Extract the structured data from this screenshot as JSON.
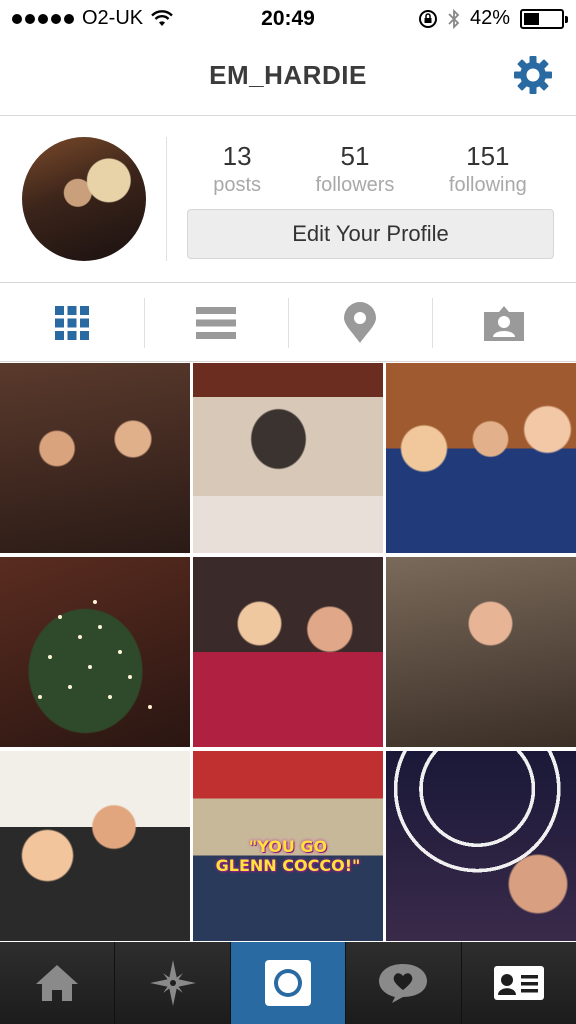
{
  "status_bar": {
    "carrier": "O2-UK",
    "time": "20:49",
    "battery": "42%",
    "battery_level": 0.42
  },
  "nav": {
    "title": "EM_HARDIE",
    "settings_icon": "gear-icon"
  },
  "profile": {
    "stats": [
      {
        "value": "13",
        "label": "posts"
      },
      {
        "value": "51",
        "label": "followers"
      },
      {
        "value": "151",
        "label": "following"
      }
    ],
    "edit_button": "Edit Your Profile"
  },
  "view_tabs": [
    {
      "icon": "grid-icon",
      "selected": true
    },
    {
      "icon": "list-icon",
      "selected": false
    },
    {
      "icon": "location-pin-icon",
      "selected": false
    },
    {
      "icon": "tagged-photos-icon",
      "selected": false
    }
  ],
  "grid": {
    "photo_captions": {
      "p8": [
        "\"YOU GO",
        "GLENN COCCO!\""
      ]
    }
  },
  "tabbar": [
    {
      "icon": "home-icon",
      "selected": false
    },
    {
      "icon": "explore-icon",
      "selected": false
    },
    {
      "icon": "camera-icon",
      "selected": true
    },
    {
      "icon": "activity-icon",
      "selected": false
    },
    {
      "icon": "profile-icon",
      "selected": false
    }
  ],
  "colors": {
    "accent": "#2a6aa3",
    "icon_gray": "#9a9a9a",
    "tabbar_bg": "#1e1e1e"
  }
}
